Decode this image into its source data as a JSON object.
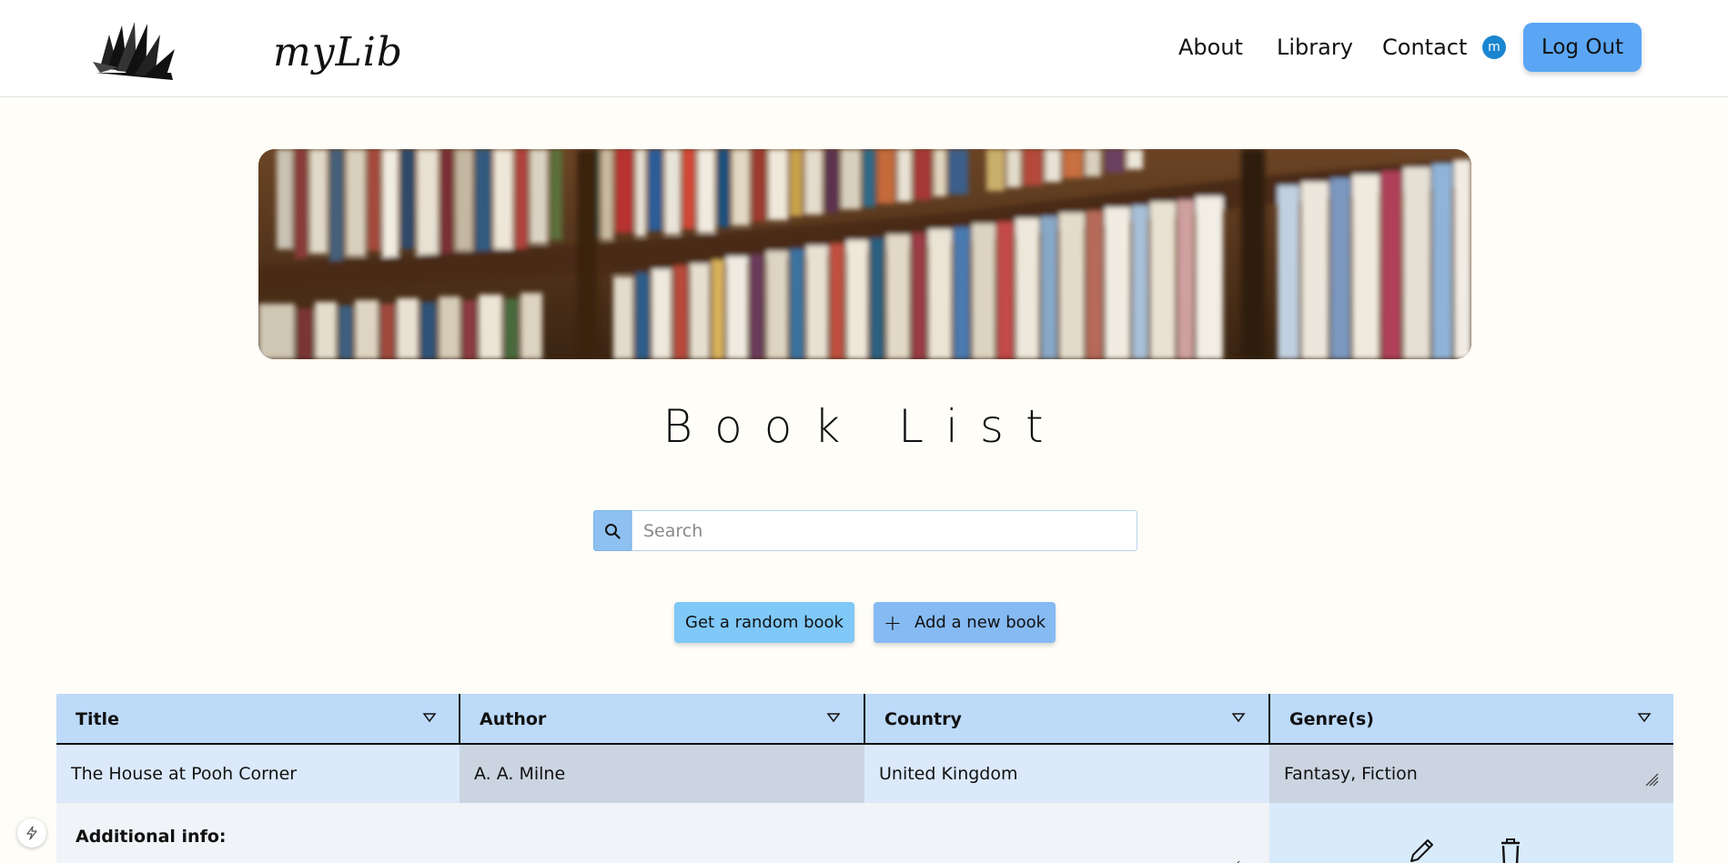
{
  "header": {
    "logo_text": "myLib",
    "nav": [
      {
        "label": "About"
      },
      {
        "label": "Library"
      },
      {
        "label": "Contact"
      }
    ],
    "avatar_initial": "m",
    "logout_label": "Log Out"
  },
  "main": {
    "title": "Book List",
    "search": {
      "placeholder": "Search",
      "value": ""
    },
    "random_button_label": "Get a random book",
    "add_button_label": "Add a new book"
  },
  "table": {
    "columns": [
      "Title",
      "Author",
      "Country",
      "Genre(s)"
    ],
    "rows": [
      {
        "title": "The House at Pooh Corner",
        "author": "A. A. Milne",
        "country": "United Kingdom",
        "genres": "Fantasy, Fiction"
      }
    ],
    "additional_info_label": "Additional info:"
  },
  "colors": {
    "accent": "#5aa6f5",
    "header_row": "#bddaf9",
    "random_button": "#7fc8f8",
    "add_button": "#86baf3"
  },
  "icons": [
    "book-logo-icon",
    "search-icon",
    "plus-icon",
    "caret-down-icon",
    "resize-handle-icon",
    "edit-pencil-icon",
    "delete-trash-icon",
    "bolt-icon"
  ]
}
